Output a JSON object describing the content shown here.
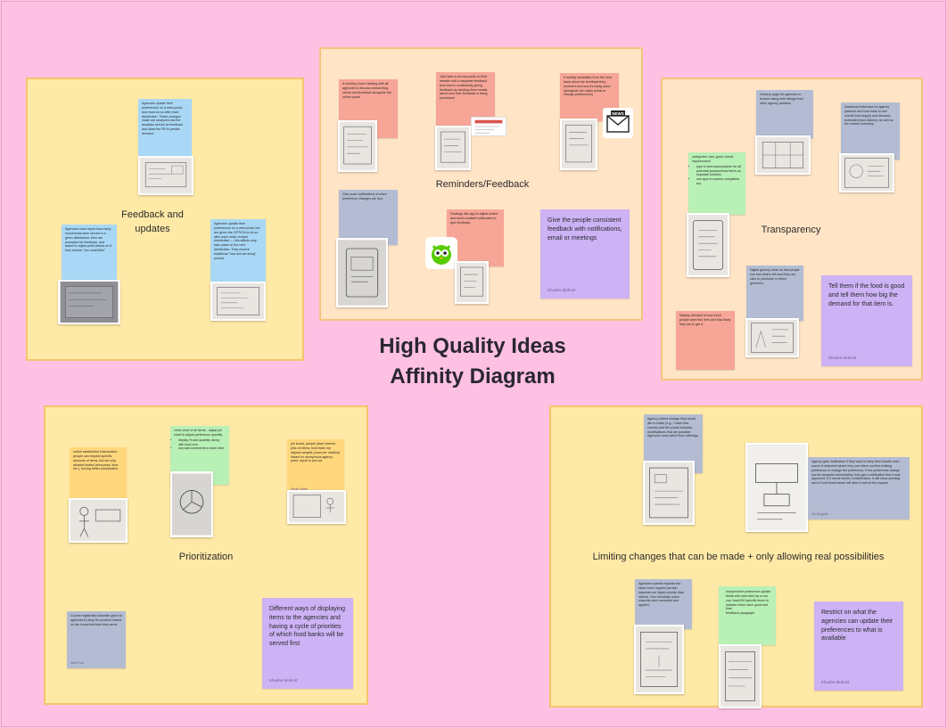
{
  "main_title": {
    "line1": "High Quality Ideas",
    "line2": "Affinity Diagram"
  },
  "groups": {
    "feedback": {
      "title_line1": "Feedback and",
      "title_line2": "updates",
      "notes": [
        "Agencies update their preferences on a web portal, and must do so after each distribution. These changes made are analyzed and the analytics served as feedback and allow the FB to predict demand.",
        "Agencies must report how many households were served in a given distribution; then are prompted for feedback, and asked to adjust prefs based on if they receive \"too much/little\"",
        "Agencies update their preferences on a web portal, but are given the OPTION to do so after each order receipt/ distribution — this affects only take place on the next distribution. They receive traditional \"how are we doing\" prompt"
      ]
    },
    "reminders": {
      "title": "Reminders/Feedback",
      "notes": [
        "A monthly zoom meeting with all agencies to discuss overarching needs and feedback alongside the online portal",
        "Just have a normal portal on their website with a separate feedback form that is consistently giving feedback by sending them emails about how their feedback is being processed",
        "A weekly newsletter from the food bank about the feedback they received and how it's being used. (alongside the online portal to change preferences)",
        "Give push notifications of when preference changes are due.",
        "Duolingo like app to adjust orders and send constant notification to give feedback"
      ],
      "summary": "Give the people consistent feedback with notifications, email or meetings",
      "author": "Khusbn Mohost",
      "newspaper_text": "NEWS"
    },
    "transparency": {
      "title": "Transparency",
      "notes": [
        "Grocery page for agencies to browse along with ratings from other agency partners",
        "Dashboard interface for agency partners and food bank to see overall food supply and demand, estimated food delivery, as well as the current inventory"
      ],
      "categories_note": {
        "intro": "categories: bad, good, needs improvement",
        "items": [
          "type in and autocomplete for all potential produce/food items as separate bubbles",
          "can type in custom complaints too"
        ]
      },
      "digital_store_note": "Digital grocery store so that people can see what's left and they can click to purchase or return groceries.",
      "demand_note": "Display demand of how much people want this item and how likely they are to get it",
      "summary": "Tell them if the food is good and tell them how big the demand for that item is.",
      "author": "Khusbn Mohost"
    },
    "prioritization": {
      "title": "Prioritization",
      "auction_note": "online established chat auction - people can request specific amounts of items, but are only allowed limited (resources, time, etc.), forcing better prioritization",
      "circle_chart_note": {
        "intro": "circle chart of all items - adjust pin chart to adjust preference quantity",
        "items": [
          "display % and quantity along with food icon",
          "can add comments to each slice"
        ]
      },
      "pin_board_note": "pin board, people place interest pins on items, food bank rep adjusts weights (once per rotation) based on anonymous agency prefs. report is put out",
      "pin_board_author": "Sarah Wane",
      "course_note": "Course registration blackish given to agencies to shop for produce based on the household size they serve",
      "course_author": "Steel Fox",
      "summary": "Different ways of displaying items to the agencies and having a cycle of priorities of which food banks will be served first",
      "author": "Khusbn Mohost"
    },
    "limiting": {
      "title": "Limiting changes that can be made + only allowing real possibilities",
      "agency_orders_note": "Agency orders change they would like to make (e.g., I want less carrots) and the portal indicates modifications that are possible. Agencies must select from offerings.",
      "notification_note": "Agency gets notification if they want to keep their bundle each round of shipment where they can either confirm existing preference or change the preference. If the preference change can be accepted immediately, they get a notification that it was approved. If it needs further consideration, it will show pending and a Food Bank based will take a look at the request.",
      "notification_author": "Jim Mcguire",
      "submit_note": "Agencies submit requests but ranks each request (certain requests are higher priority than others). Give feedback when requests were accepted and applied.",
      "independent_note": {
        "items": [
          "Independent preference update fields with each item as a row",
          "can 'heart'/00 specific items to indicate which were good last time",
          "feedback paragraph"
        ]
      },
      "summary": "Restrict on what the agencies can update their preferences to what is available",
      "author": "Khusbn Mohost"
    }
  },
  "colors": {
    "background": "#ffc1e3",
    "group_yellow": "#ffe9a6",
    "group_peach": "#ffe4c6",
    "note_blue": "#a9d8f6",
    "note_salmon": "#f6a596",
    "note_slate": "#b3bcd2",
    "note_green": "#b8f0b5",
    "note_orange": "#ffd77c",
    "note_lavender": "#cdb2f5"
  },
  "icons": [
    "sketch-photo",
    "newspaper-icon",
    "duolingo-owl-icon",
    "email-form-thumbnail"
  ]
}
